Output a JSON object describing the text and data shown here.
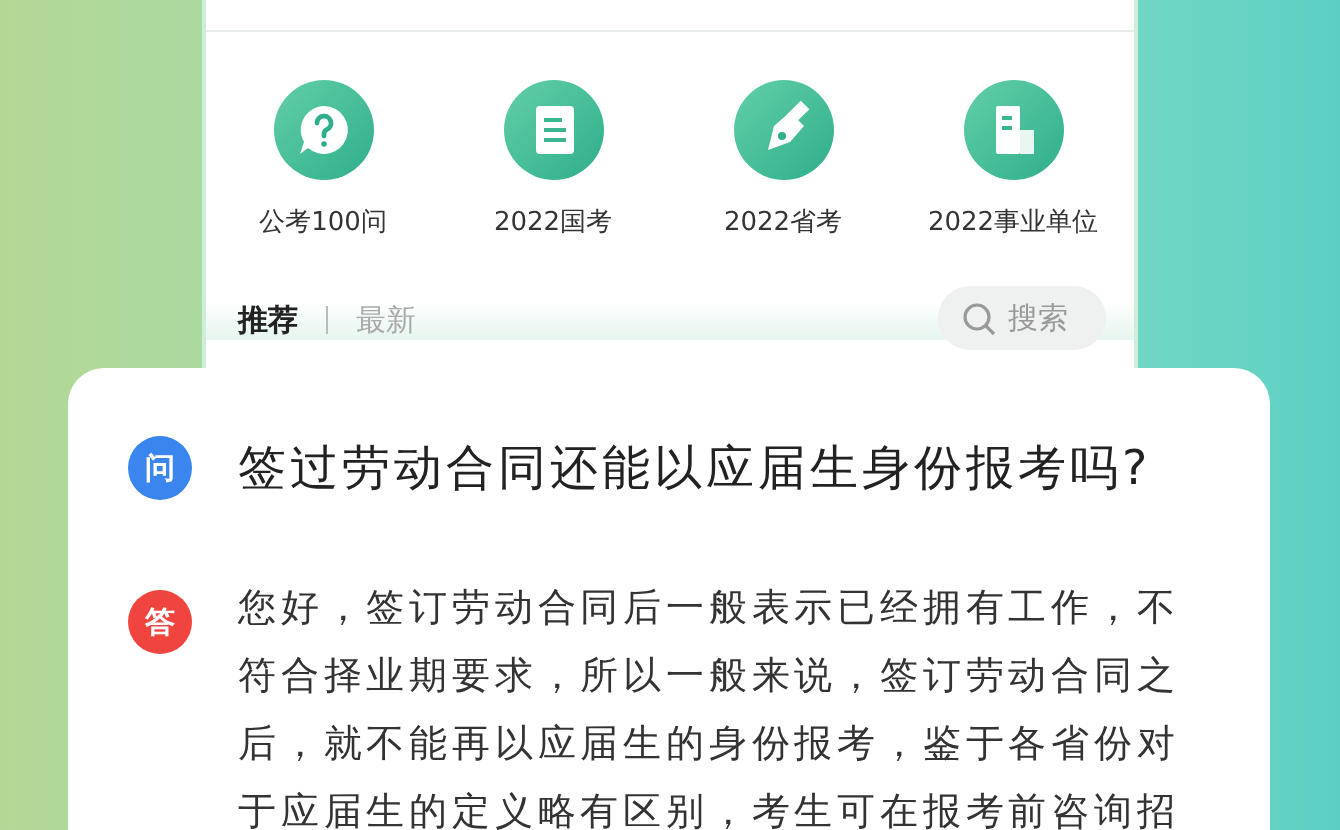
{
  "shortcuts": [
    {
      "label": "公考100问",
      "kind": "question"
    },
    {
      "label": "2022国考",
      "kind": "document"
    },
    {
      "label": "2022省考",
      "kind": "pen"
    },
    {
      "label": "2022事业单位",
      "kind": "building"
    }
  ],
  "feed_tabs": [
    {
      "label": "推荐",
      "selected": true
    },
    {
      "label": "最新",
      "selected": false
    }
  ],
  "search": {
    "placeholder": "搜索"
  },
  "qa": {
    "question_badge": "问",
    "question": "签过劳动合同还能以应届生身份报考吗?",
    "answer_badge": "答",
    "answer": "您好，签订劳动合同后一般表示已经拥有工作，不符合择业期要求，所以一般来说，签订劳动合同之后，就不能再以应届生的身份报考，鉴于各省份对于应届生的定义略有区别，考生可在报考前咨询招"
  }
}
